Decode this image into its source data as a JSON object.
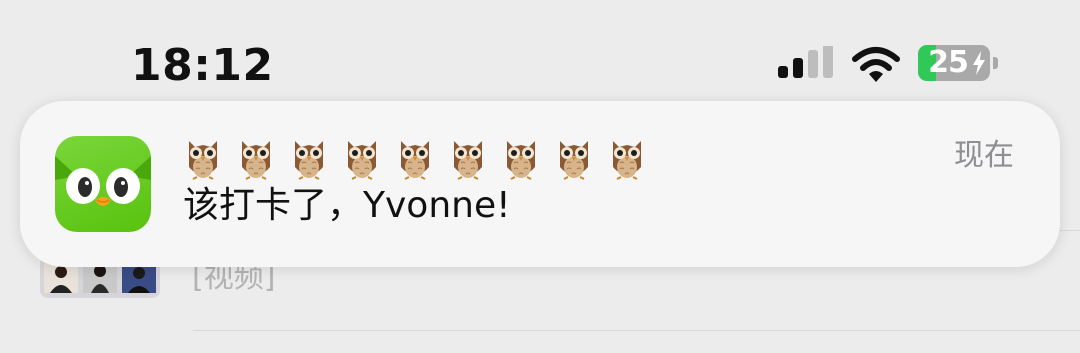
{
  "status_bar": {
    "time": "18:12",
    "battery_level": "25",
    "battery_percent": 25,
    "battery_color": "#30c957",
    "charging": true,
    "icons": [
      "cellular-signal-icon",
      "wifi-icon",
      "battery-icon",
      "charging-bolt-icon"
    ]
  },
  "notification": {
    "app_icon": "duolingo-owl-icon",
    "app_icon_color": "#58cc02",
    "title_emoji": "owl",
    "title_emoji_count": 9,
    "body": "该打卡了，Yvonne!",
    "time": "现在"
  },
  "background": {
    "row_text": "[视频]"
  }
}
